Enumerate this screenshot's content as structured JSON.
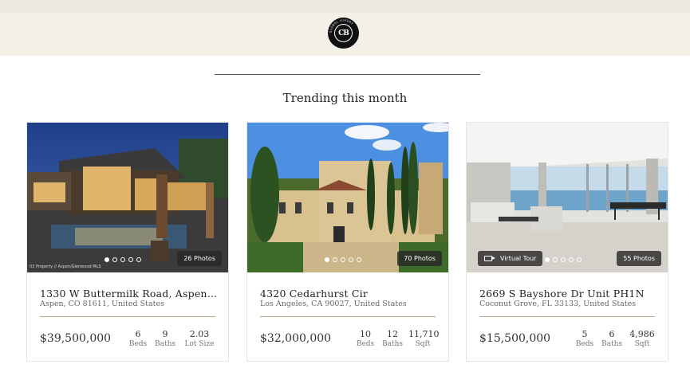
{
  "brand": {
    "logo_text": "CB",
    "logo_ring_text": "GLOBAL LUXURY"
  },
  "section": {
    "title": "Trending this month"
  },
  "listings": [
    {
      "address": "1330 W Buttermilk Road, Aspen,...",
      "city": "Aspen, CO 81611, United States",
      "price": "$39,500,000",
      "stats": [
        {
          "value": "6",
          "label": "Beds"
        },
        {
          "value": "9",
          "label": "Baths"
        },
        {
          "value": "2.03",
          "label": "Lot Size"
        }
      ],
      "photos_label": "26 Photos",
      "credit": "03 Property // Aspen/Glenwood MLS",
      "active_dot": 0,
      "dot_count": 5
    },
    {
      "address": "4320 Cedarhurst Cir",
      "city": "Los Angeles, CA 90027, United States",
      "price": "$32,000,000",
      "stats": [
        {
          "value": "10",
          "label": "Beds"
        },
        {
          "value": "12",
          "label": "Baths"
        },
        {
          "value": "11,710",
          "label": "Sqft"
        }
      ],
      "photos_label": "70 Photos",
      "active_dot": 0,
      "dot_count": 5
    },
    {
      "address": "2669 S Bayshore Dr Unit PH1N",
      "city": "Coconut Grove, FL 33133, United States",
      "price": "$15,500,000",
      "stats": [
        {
          "value": "5",
          "label": "Beds"
        },
        {
          "value": "6",
          "label": "Baths"
        },
        {
          "value": "4,986",
          "label": "Sqft"
        }
      ],
      "photos_label": "55 Photos",
      "virtual_tour_label": "Virtual Tour",
      "active_dot": 0,
      "dot_count": 5
    }
  ]
}
